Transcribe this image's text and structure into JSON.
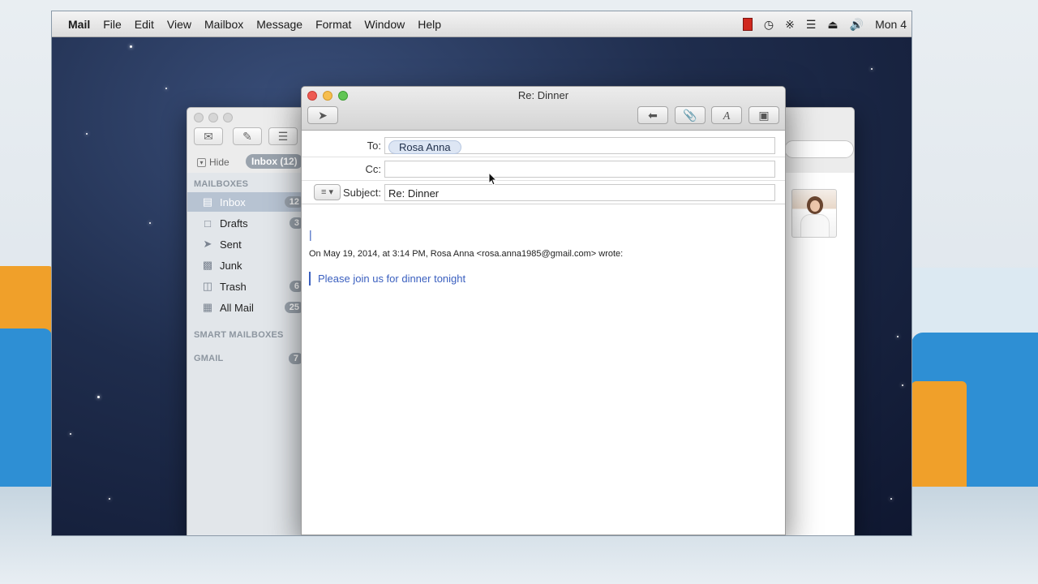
{
  "menubar": {
    "app": "Mail",
    "items": [
      "File",
      "Edit",
      "View",
      "Mailbox",
      "Message",
      "Format",
      "Window",
      "Help"
    ],
    "clock": "Mon 4"
  },
  "viewer": {
    "hide_label": "Hide",
    "inbox_pill": "Inbox (12)",
    "headers": {
      "mailboxes": "MAILBOXES",
      "smart": "SMART MAILBOXES",
      "gmail": "GMAIL"
    },
    "gmail_count": "7",
    "mailboxes": [
      {
        "label": "Inbox",
        "count": "12",
        "icon": "inbox-icon"
      },
      {
        "label": "Drafts",
        "count": "3",
        "icon": "drafts-icon"
      },
      {
        "label": "Sent",
        "count": "",
        "icon": "sent-icon"
      },
      {
        "label": "Junk",
        "count": "",
        "icon": "junk-icon"
      },
      {
        "label": "Trash",
        "count": "6",
        "icon": "trash-icon"
      },
      {
        "label": "All Mail",
        "count": "25",
        "icon": "all-mail-icon"
      }
    ]
  },
  "compose": {
    "title": "Re: Dinner",
    "to_label": "To:",
    "to_recipient": "Rosa Anna",
    "cc_label": "Cc:",
    "cc_value": "",
    "subject_label": "Subject:",
    "subject_value": "Re: Dinner",
    "cursor_text": "|",
    "attribution": "On May 19, 2014, at 3:14 PM, Rosa Anna <rosa.anna1985@gmail.com> wrote:",
    "quoted_text": "Please join us for dinner tonight"
  },
  "colors": {
    "quote_blue": "#3a5fbf",
    "close": "#ee5b53",
    "minimize": "#f6be4f",
    "zoom": "#61c554"
  }
}
